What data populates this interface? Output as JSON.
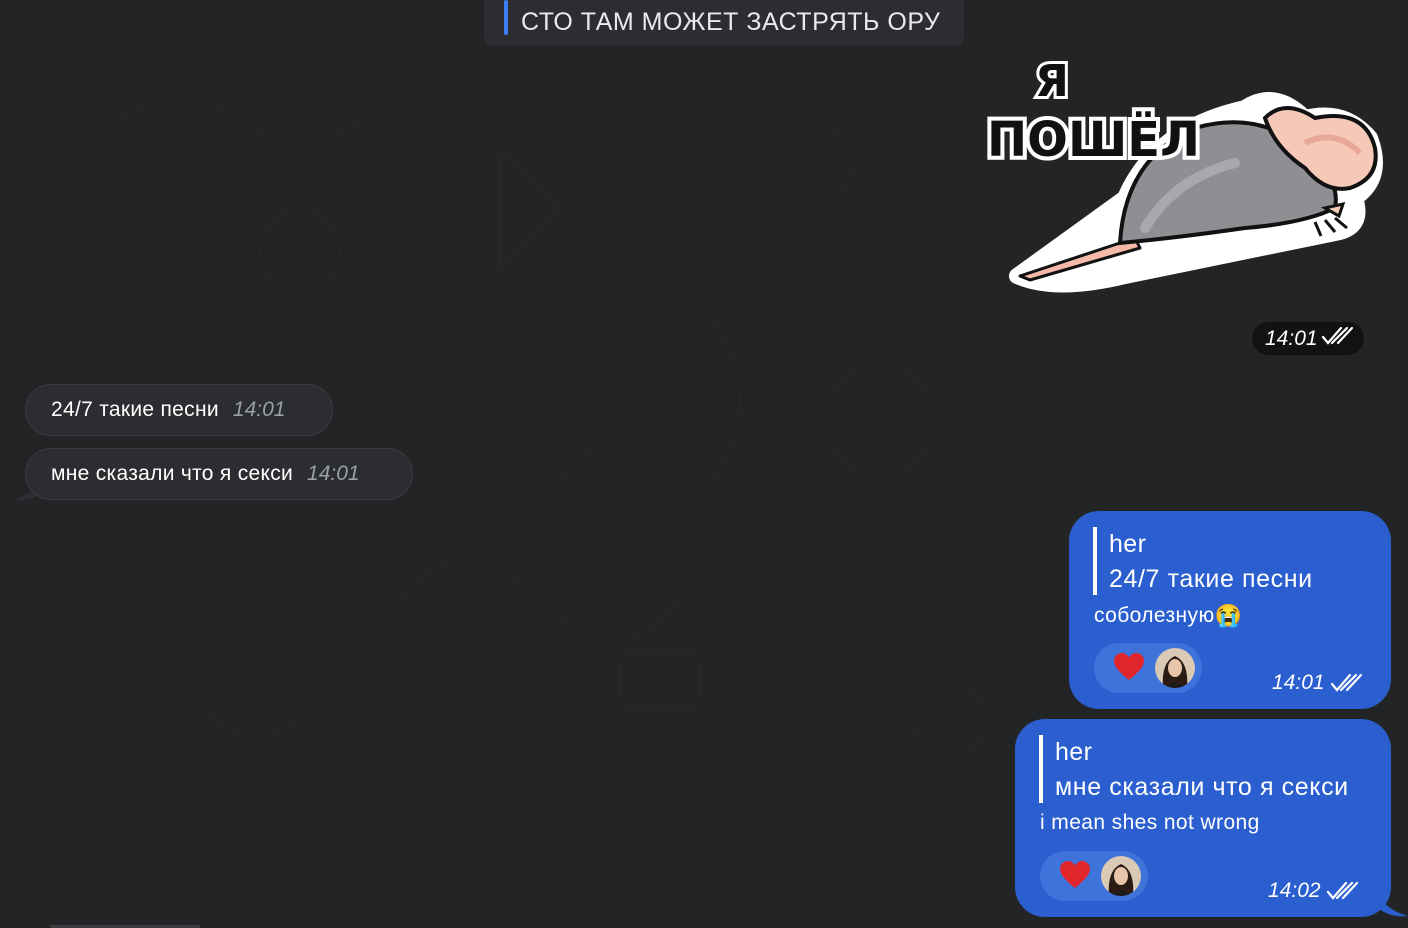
{
  "pinned": {
    "text": "СТО ТАМ МОЖЕТ ЗАСТРЯТЬ ОРУ"
  },
  "sticker": {
    "caption_line1": "Я",
    "caption_line2": "ПОШЁЛ",
    "time": "14:01"
  },
  "incoming": [
    {
      "text": "24/7 такие песни",
      "time": "14:01"
    },
    {
      "text": "мне сказали что я секси",
      "time": "14:01"
    }
  ],
  "outgoing": [
    {
      "reply_name": "her",
      "reply_quote": "24/7 такие песни",
      "text": "соболезную",
      "emoji": "😭",
      "reaction": "❤️",
      "time": "14:01"
    },
    {
      "reply_name": "her",
      "reply_quote": "мне сказали что я секси",
      "text": "i mean shes not wrong",
      "reaction": "❤️",
      "time": "14:02"
    }
  ],
  "colors": {
    "background": "#222426",
    "incoming_bubble": "#2b2d30",
    "outgoing_bubble": "#2b5fd0",
    "accent": "#3d7ff5"
  }
}
